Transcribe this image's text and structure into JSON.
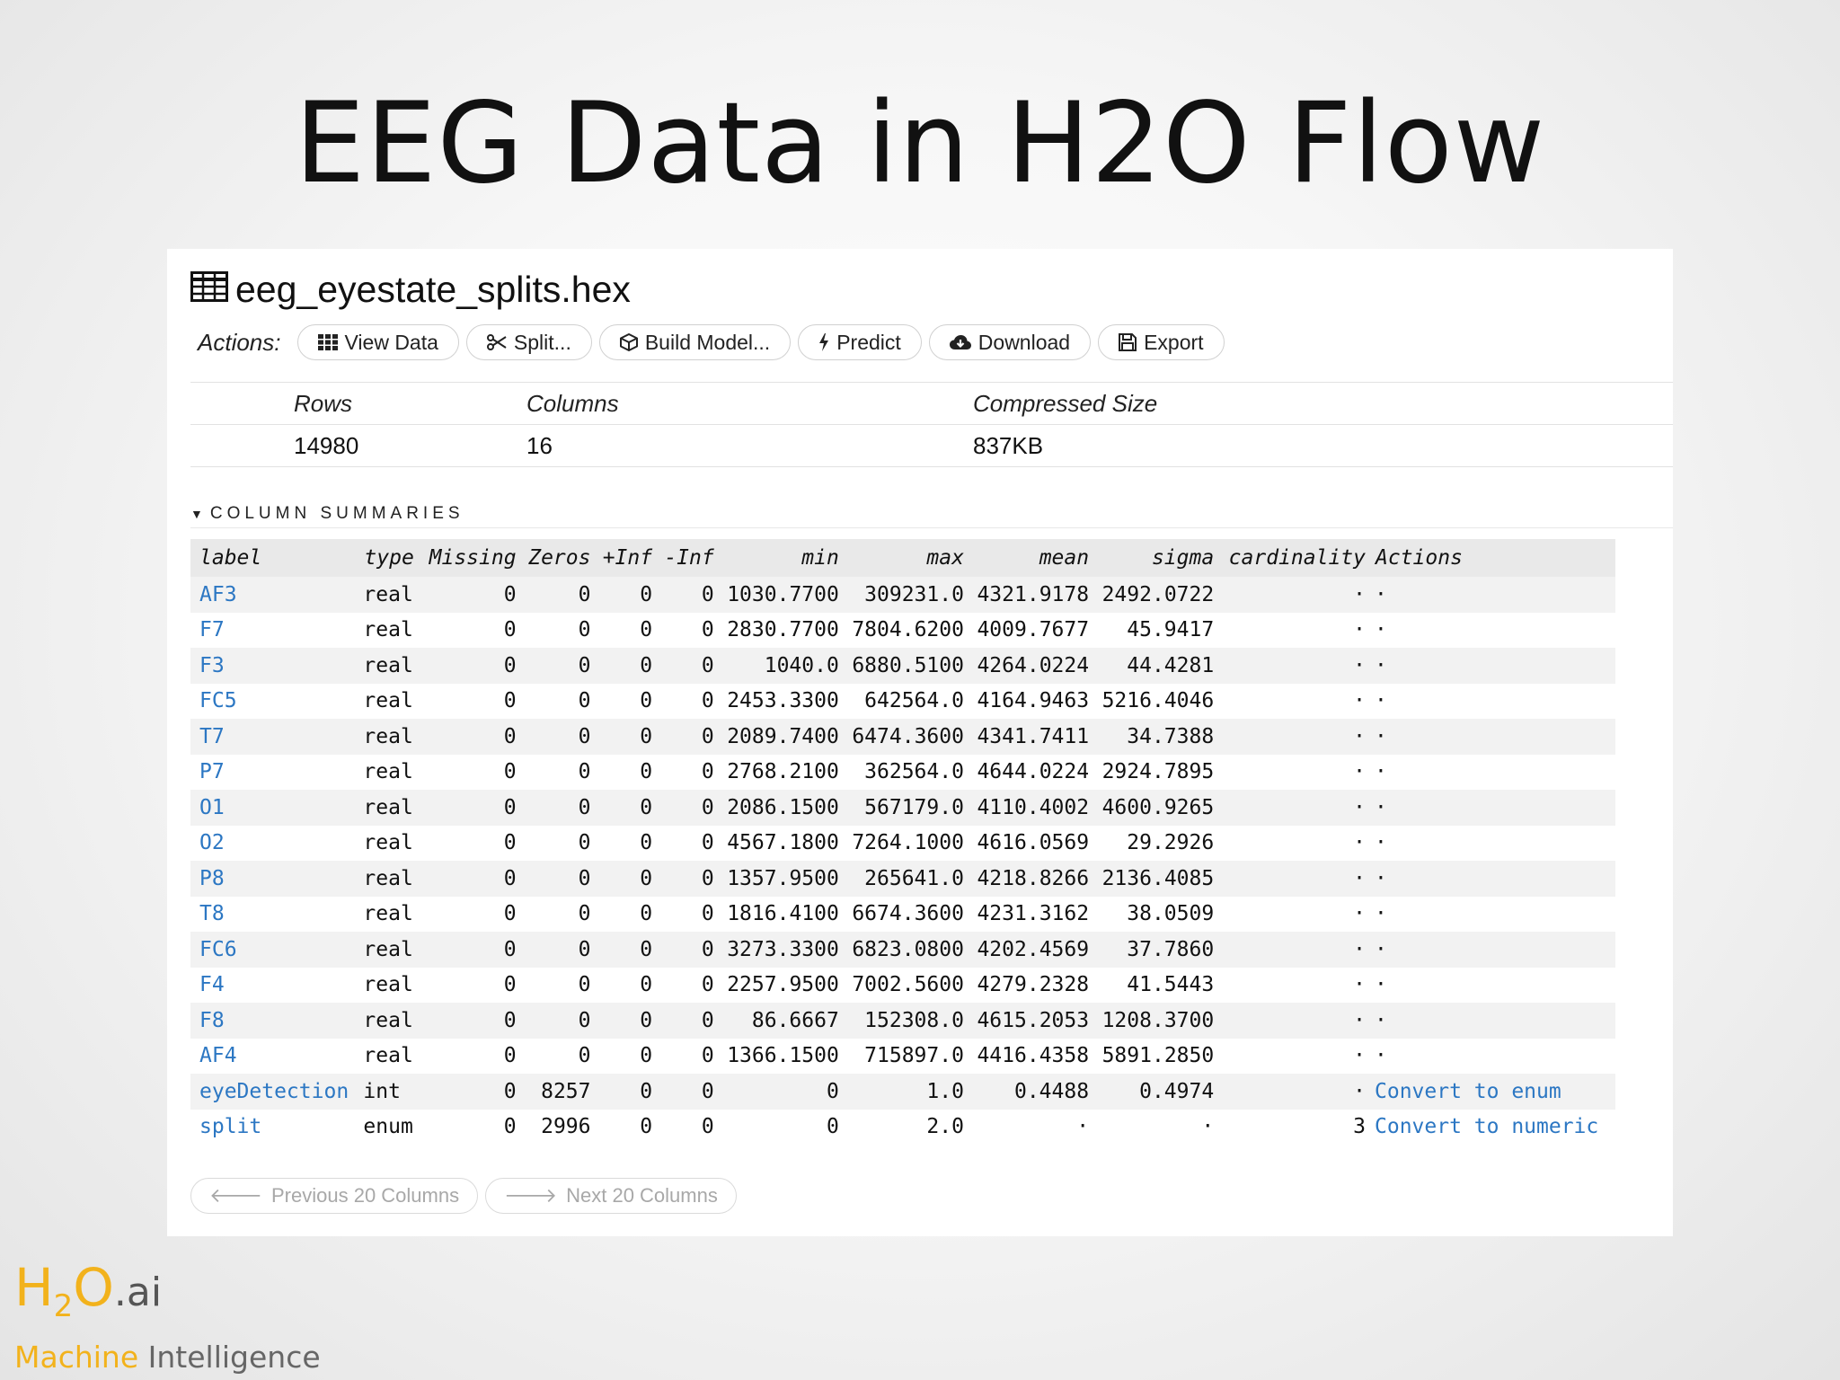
{
  "slide": {
    "title": "EEG Data in H2O Flow"
  },
  "frame": {
    "name": "eeg_eyestate_splits.hex",
    "actions_label": "Actions:",
    "buttons": [
      {
        "label": "View Data",
        "icon": "grid-icon"
      },
      {
        "label": "Split...",
        "icon": "scissors-icon"
      },
      {
        "label": "Build Model...",
        "icon": "cube-icon"
      },
      {
        "label": "Predict",
        "icon": "bolt-icon"
      },
      {
        "label": "Download",
        "icon": "cloud-download-icon"
      },
      {
        "label": "Export",
        "icon": "floppy-icon"
      }
    ]
  },
  "summary": {
    "headers": {
      "rows": "Rows",
      "columns": "Columns",
      "size": "Compressed Size"
    },
    "values": {
      "rows": "14980",
      "columns": "16",
      "size": "837KB"
    }
  },
  "section": {
    "title": "COLUMN SUMMARIES"
  },
  "table": {
    "headers": [
      "label",
      "type",
      "Missing",
      "Zeros",
      "+Inf",
      "-Inf",
      "min",
      "max",
      "mean",
      "sigma",
      "cardinality",
      "Actions"
    ],
    "rows": [
      [
        "AF3",
        "real",
        "0",
        "0",
        "0",
        "0",
        "1030.7700",
        "309231.0",
        "4321.9178",
        "2492.0722",
        "·",
        "·"
      ],
      [
        "F7",
        "real",
        "0",
        "0",
        "0",
        "0",
        "2830.7700",
        "7804.6200",
        "4009.7677",
        "45.9417",
        "·",
        "·"
      ],
      [
        "F3",
        "real",
        "0",
        "0",
        "0",
        "0",
        "1040.0",
        "6880.5100",
        "4264.0224",
        "44.4281",
        "·",
        "·"
      ],
      [
        "FC5",
        "real",
        "0",
        "0",
        "0",
        "0",
        "2453.3300",
        "642564.0",
        "4164.9463",
        "5216.4046",
        "·",
        "·"
      ],
      [
        "T7",
        "real",
        "0",
        "0",
        "0",
        "0",
        "2089.7400",
        "6474.3600",
        "4341.7411",
        "34.7388",
        "·",
        "·"
      ],
      [
        "P7",
        "real",
        "0",
        "0",
        "0",
        "0",
        "2768.2100",
        "362564.0",
        "4644.0224",
        "2924.7895",
        "·",
        "·"
      ],
      [
        "O1",
        "real",
        "0",
        "0",
        "0",
        "0",
        "2086.1500",
        "567179.0",
        "4110.4002",
        "4600.9265",
        "·",
        "·"
      ],
      [
        "O2",
        "real",
        "0",
        "0",
        "0",
        "0",
        "4567.1800",
        "7264.1000",
        "4616.0569",
        "29.2926",
        "·",
        "·"
      ],
      [
        "P8",
        "real",
        "0",
        "0",
        "0",
        "0",
        "1357.9500",
        "265641.0",
        "4218.8266",
        "2136.4085",
        "·",
        "·"
      ],
      [
        "T8",
        "real",
        "0",
        "0",
        "0",
        "0",
        "1816.4100",
        "6674.3600",
        "4231.3162",
        "38.0509",
        "·",
        "·"
      ],
      [
        "FC6",
        "real",
        "0",
        "0",
        "0",
        "0",
        "3273.3300",
        "6823.0800",
        "4202.4569",
        "37.7860",
        "·",
        "·"
      ],
      [
        "F4",
        "real",
        "0",
        "0",
        "0",
        "0",
        "2257.9500",
        "7002.5600",
        "4279.2328",
        "41.5443",
        "·",
        "·"
      ],
      [
        "F8",
        "real",
        "0",
        "0",
        "0",
        "0",
        "86.6667",
        "152308.0",
        "4615.2053",
        "1208.3700",
        "·",
        "·"
      ],
      [
        "AF4",
        "real",
        "0",
        "0",
        "0",
        "0",
        "1366.1500",
        "715897.0",
        "4416.4358",
        "5891.2850",
        "·",
        "·"
      ],
      [
        "eyeDetection",
        "int",
        "0",
        "8257",
        "0",
        "0",
        "0",
        "1.0",
        "0.4488",
        "0.4974",
        "·",
        "Convert to enum"
      ],
      [
        "split",
        "enum",
        "0",
        "2996",
        "0",
        "0",
        "0",
        "2.0",
        "·",
        "·",
        "3",
        "Convert to numeric"
      ]
    ]
  },
  "pager": {
    "prev": "Previous 20 Columns",
    "next": "Next 20 Columns"
  },
  "logo": {
    "h": "H",
    "two": "2",
    "o": "O",
    "ai": ".ai",
    "tag1": "Machine",
    "tag2": "Intelligence"
  },
  "colors": {
    "brand": "#f2b21c",
    "link": "#2c77c3"
  }
}
